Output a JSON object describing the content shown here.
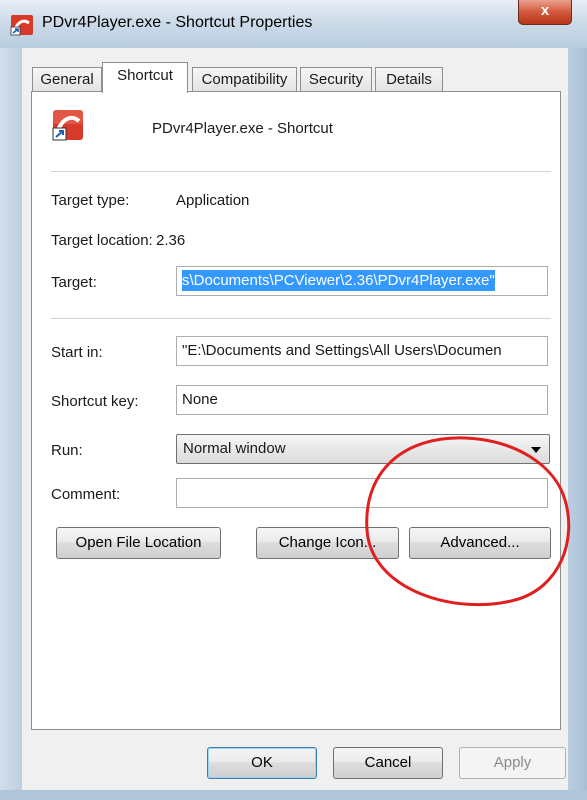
{
  "window": {
    "title": "PDvr4Player.exe - Shortcut Properties",
    "close_glyph": "x"
  },
  "tabs": [
    {
      "label": "General",
      "active": false
    },
    {
      "label": "Shortcut",
      "active": true
    },
    {
      "label": "Compatibility",
      "active": false
    },
    {
      "label": "Security",
      "active": false
    },
    {
      "label": "Details",
      "active": false
    }
  ],
  "shortcut": {
    "name": "PDvr4Player.exe - Shortcut",
    "target_type_label": "Target type:",
    "target_type_value": "Application",
    "target_location_label": "Target location:",
    "target_location_value": "2.36",
    "target_label": "Target:",
    "target_value": "s\\Documents\\PCViewer\\2.36\\PDvr4Player.exe\"",
    "start_in_label": "Start in:",
    "start_in_value": "\"E:\\Documents and Settings\\All Users\\Documen",
    "shortcut_key_label": "Shortcut key:",
    "shortcut_key_value": "None",
    "run_label": "Run:",
    "run_value": "Normal window",
    "comment_label": "Comment:",
    "comment_value": ""
  },
  "actions": {
    "open_file_location": "Open File Location",
    "change_icon": "Change Icon...",
    "advanced": "Advanced..."
  },
  "footer": {
    "ok": "OK",
    "cancel": "Cancel",
    "apply": "Apply"
  },
  "colors": {
    "selection": "#3399ff",
    "annotation": "#e02020"
  },
  "icons": {
    "title": "shortcut-app-icon",
    "large": "app-shortcut-icon"
  }
}
